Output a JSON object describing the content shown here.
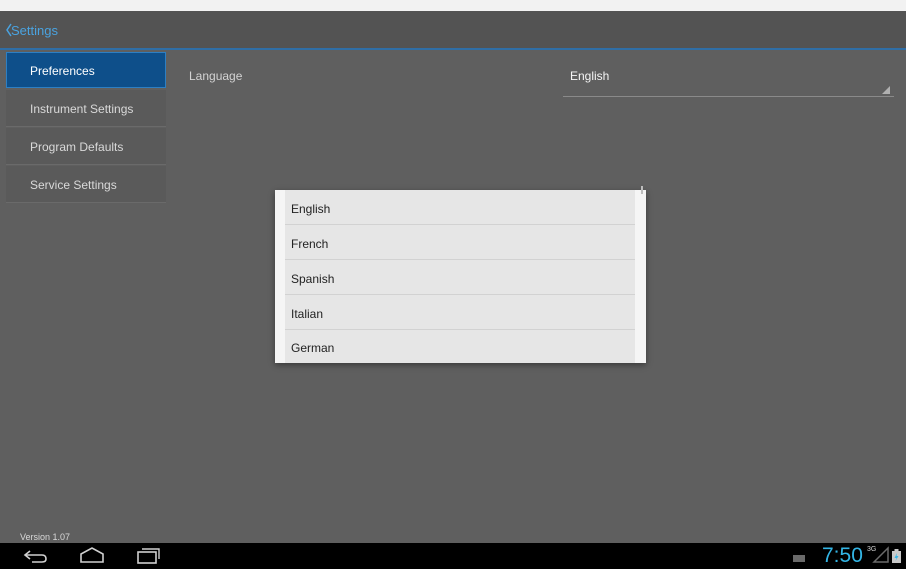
{
  "header": {
    "title": "Settings"
  },
  "sidebar": {
    "items": [
      {
        "label": "Preferences",
        "selected": true
      },
      {
        "label": "Instrument Settings",
        "selected": false
      },
      {
        "label": "Program Defaults",
        "selected": false
      },
      {
        "label": "Service Settings",
        "selected": false
      }
    ]
  },
  "preferences": {
    "language_label": "Language",
    "language_value": "English"
  },
  "popup": {
    "options": [
      "English",
      "French",
      "Spanish",
      "Italian",
      "German"
    ]
  },
  "footer": {
    "version": "Version   1.07"
  },
  "system_bar": {
    "time": "7:50",
    "network": "3G",
    "icons": [
      "back-icon",
      "home-icon",
      "recent-apps-icon",
      "keyboard-icon",
      "signal-icon",
      "battery-icon"
    ]
  },
  "colors": {
    "accent": "#33b5e5",
    "selected_nav": "#0e4f8a",
    "background": "#5f5f5f"
  }
}
